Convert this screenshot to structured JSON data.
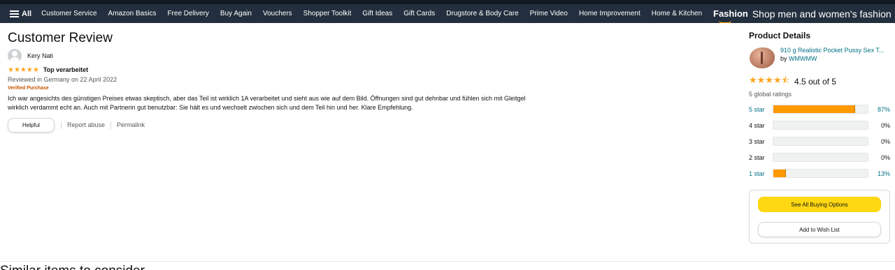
{
  "nav": {
    "all_label": "All",
    "items": [
      "Customer Service",
      "Amazon Basics",
      "Free Delivery",
      "Buy Again",
      "Vouchers",
      "Shopper Toolkit",
      "Gift Ideas",
      "Gift Cards",
      "Drugstore & Body Care",
      "Prime Video",
      "Home Improvement",
      "Home & Kitchen"
    ],
    "promo_logo": "Fashion",
    "promo_text": "Shop men and women's fashion"
  },
  "review": {
    "page_title": "Customer Review",
    "reviewer_name": "Kery Nati",
    "star_rating": 5,
    "stars_display": "★★★★★",
    "headline": "Top verarbeitet",
    "date_line": "Reviewed in Germany on 22 April 2022",
    "verified": "Verified Purchase",
    "body": "Ich war angesichts des günstigen Preises etwas skeptisch, aber das Teil ist wirklich 1A verarbeitet und sieht aus wie auf dem Bild. Öffnungen sind gut dehnbar und fühlen sich mit Gleitgel wirklich verdammt echt an. Auch mit Partnerin gut benutzbar: Sie hält es und wechselt zwischen sich und dem Teil hin und her. Klare Empfehlung.",
    "helpful_label": "Helpful",
    "report_label": "Report abuse",
    "permalink_label": "Permalink"
  },
  "bottom": {
    "cut_heading": "Similar items to consider"
  },
  "panel": {
    "title": "Product Details",
    "product_name": "910 g Realistic Pocket Pussy Sex T...",
    "by_prefix": "by",
    "brand": "WMWMW",
    "rating_value": 4.5,
    "stars_display": "★★★★⯪",
    "rating_text": "4.5 out of 5",
    "global_ratings": "5 global ratings",
    "histogram": [
      {
        "label": "5 star",
        "percent_text": "87%",
        "percent": 87,
        "active": true
      },
      {
        "label": "4 star",
        "percent_text": "0%",
        "percent": 0,
        "active": false
      },
      {
        "label": "3 star",
        "percent_text": "0%",
        "percent": 0,
        "active": false
      },
      {
        "label": "2 star",
        "percent_text": "0%",
        "percent": 0,
        "active": false
      },
      {
        "label": "1 star",
        "percent_text": "13%",
        "percent": 13,
        "active": true
      }
    ],
    "buy_button": "See All Buying Options",
    "wishlist_button": "Add to Wish List"
  },
  "colors": {
    "nav_bg": "#232f3e",
    "star": "#ffa41c",
    "bar_fill": "#ff9900",
    "link": "#007185",
    "verified": "#c45500",
    "buy_button": "#ffd814"
  }
}
